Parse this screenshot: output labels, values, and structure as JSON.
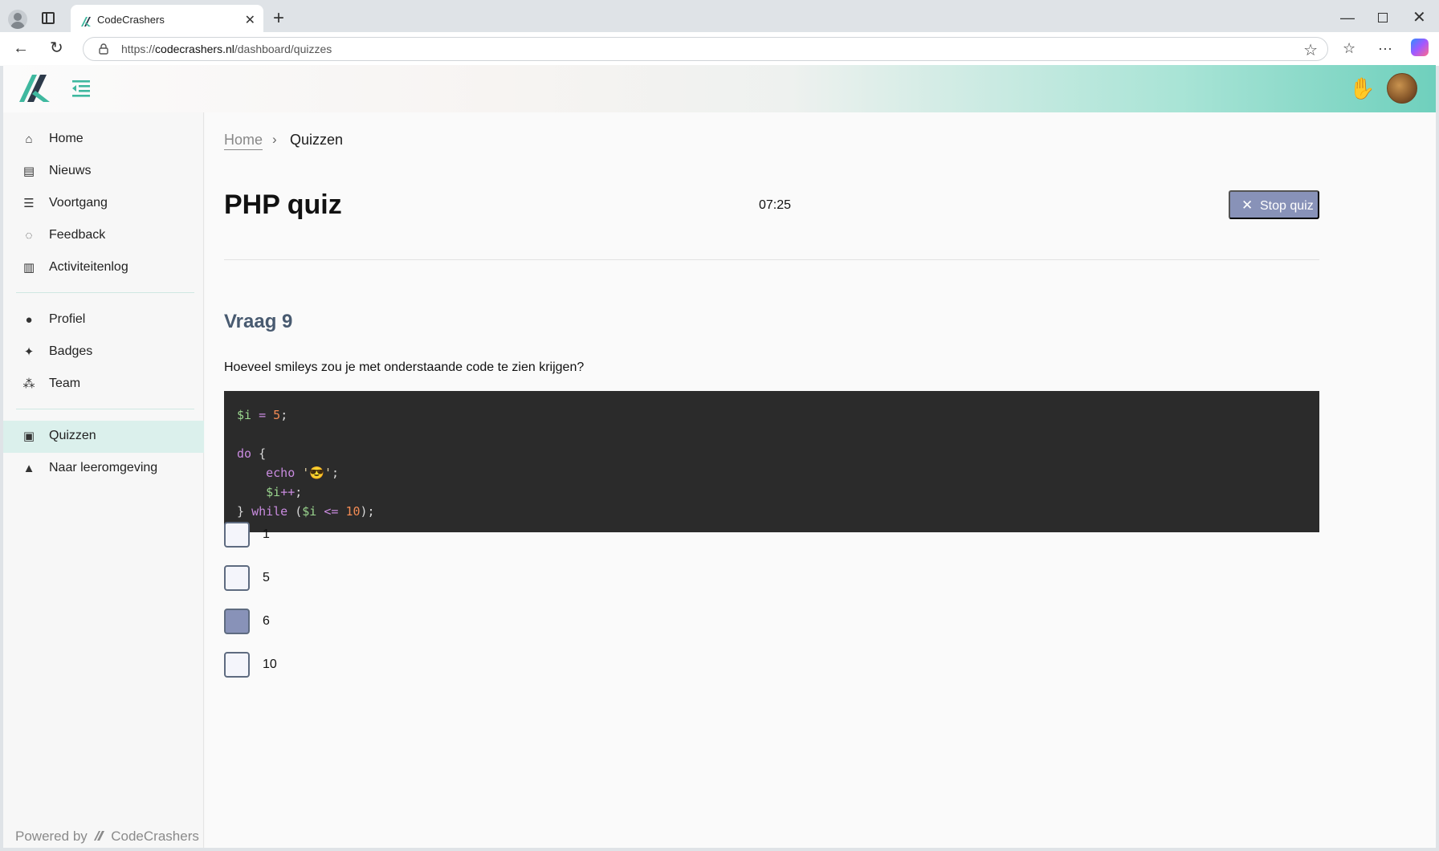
{
  "browser": {
    "tab_title": "CodeCrashers",
    "url_prefix": "https://",
    "url_host": "codecrashers.nl",
    "url_path": "/dashboard/quizzes",
    "new_tab_glyph": "+",
    "close_glyph": "✕"
  },
  "sidebar": {
    "group1": [
      {
        "label": "Home",
        "icon": "home-icon"
      },
      {
        "label": "Nieuws",
        "icon": "newspaper-icon"
      },
      {
        "label": "Voortgang",
        "icon": "list-check-icon"
      },
      {
        "label": "Feedback",
        "icon": "chat-bubble-icon"
      },
      {
        "label": "Activiteitenlog",
        "icon": "book-open-icon"
      }
    ],
    "group2": [
      {
        "label": "Profiel",
        "icon": "user-icon"
      },
      {
        "label": "Badges",
        "icon": "badge-icon"
      },
      {
        "label": "Team",
        "icon": "team-icon"
      }
    ],
    "group3": [
      {
        "label": "Quizzen",
        "icon": "clipboard-question-icon",
        "active": true
      },
      {
        "label": "Naar leeromgeving",
        "icon": "graduation-cap-icon"
      }
    ],
    "powered_prefix": "Powered by",
    "powered_brand": "CodeCrashers"
  },
  "breadcrumb": {
    "home": "Home",
    "separator": "›",
    "current": "Quizzen"
  },
  "quiz": {
    "title": "PHP quiz",
    "timer": "07:25",
    "stop_label": "Stop quiz",
    "question_number": "Vraag 9",
    "question_text": "Hoeveel smileys zou je met onderstaande code te zien krijgen?",
    "code_lines": [
      [
        {
          "t": "$i",
          "c": "c-var"
        },
        {
          "t": " ",
          "c": "c-pn"
        },
        {
          "t": "=",
          "c": "c-op"
        },
        {
          "t": " ",
          "c": "c-pn"
        },
        {
          "t": "5",
          "c": "c-num"
        },
        {
          "t": ";",
          "c": "c-pn"
        }
      ],
      [],
      [
        {
          "t": "do",
          "c": "c-kw"
        },
        {
          "t": " {",
          "c": "c-pn"
        }
      ],
      [
        {
          "t": "    ",
          "c": "c-pn"
        },
        {
          "t": "echo",
          "c": "c-kw"
        },
        {
          "t": " '😎'",
          "c": "c-str"
        },
        {
          "t": ";",
          "c": "c-pn"
        }
      ],
      [
        {
          "t": "    ",
          "c": "c-pn"
        },
        {
          "t": "$i",
          "c": "c-var"
        },
        {
          "t": "++",
          "c": "c-op"
        },
        {
          "t": ";",
          "c": "c-pn"
        }
      ],
      [
        {
          "t": "} ",
          "c": "c-pn"
        },
        {
          "t": "while",
          "c": "c-kw"
        },
        {
          "t": " (",
          "c": "c-pn"
        },
        {
          "t": "$i",
          "c": "c-var"
        },
        {
          "t": " <= ",
          "c": "c-op"
        },
        {
          "t": "10",
          "c": "c-num"
        },
        {
          "t": ");",
          "c": "c-pn"
        }
      ]
    ],
    "options": [
      {
        "label": "1",
        "checked": false
      },
      {
        "label": "5",
        "checked": false
      },
      {
        "label": "6",
        "checked": true
      },
      {
        "label": "10",
        "checked": false
      }
    ]
  },
  "colors": {
    "accent": "#6fd0bd",
    "active_nav": "#dbf0ec",
    "button": "#8892b8",
    "code_bg": "#2b2b2b"
  }
}
